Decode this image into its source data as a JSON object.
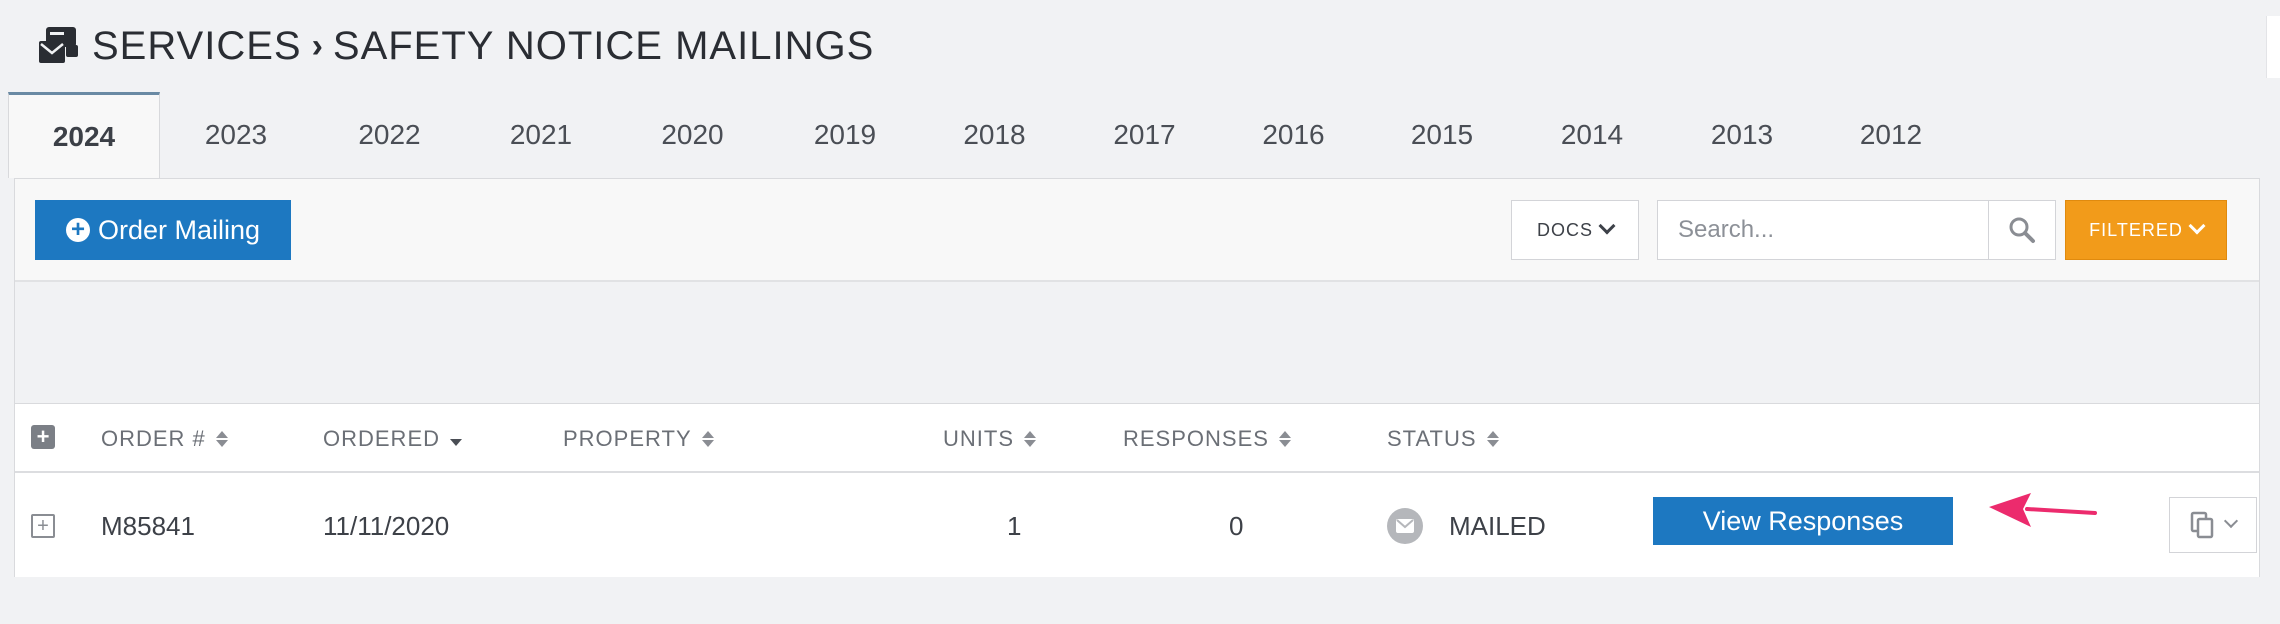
{
  "breadcrumb": {
    "section": "SERVICES",
    "page": "SAFETY NOTICE MAILINGS"
  },
  "year_tabs": [
    "2024",
    "2023",
    "2022",
    "2021",
    "2020",
    "2019",
    "2018",
    "2017",
    "2016",
    "2015",
    "2014",
    "2013",
    "2012"
  ],
  "active_tab": "2024",
  "toolbar": {
    "order_label": "Order Mailing",
    "docs_label": "DOCS",
    "search_placeholder": "Search...",
    "filtered_label": "FILTERED"
  },
  "table": {
    "columns": {
      "order": "ORDER #",
      "ordered": "ORDERED",
      "property": "PROPERTY",
      "units": "UNITS",
      "responses": "RESPONSES",
      "status": "STATUS"
    },
    "rows": [
      {
        "order": "M85841",
        "ordered": "11/11/2020",
        "property": "",
        "units": "1",
        "responses": "0",
        "status": "MAILED",
        "action_label": "View Responses"
      }
    ]
  },
  "colors": {
    "primary": "#1d78c1",
    "warning": "#f29b1a",
    "annotation_arrow": "#ec2b6d",
    "active_tab_border": "#6a8aa4"
  }
}
